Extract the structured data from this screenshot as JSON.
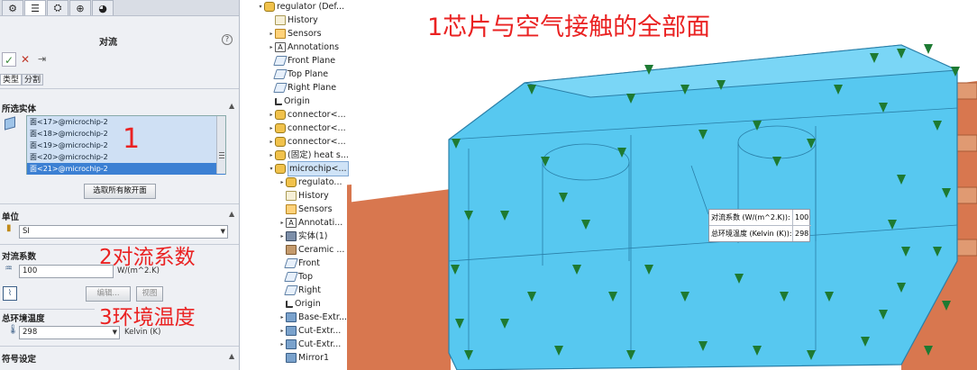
{
  "panel": {
    "tabs": [
      {
        "name": "feature-manager-tab",
        "glyph": "⚙"
      },
      {
        "name": "property-manager-tab",
        "glyph": "☰"
      },
      {
        "name": "configuration-manager-tab",
        "glyph": "⛭"
      },
      {
        "name": "dimxpert-tab",
        "glyph": "⊕"
      },
      {
        "name": "display-manager-tab",
        "glyph": "◕"
      }
    ],
    "title": "对流",
    "help_glyph": "?",
    "ok_glyph": "✓",
    "cancel_glyph": "✕",
    "pin_glyph": "⇥",
    "subtabs": [
      "类型",
      "分割"
    ],
    "selected_entities": {
      "header": "所选实体",
      "items": [
        "面<17>@microchip-2",
        "面<18>@microchip-2",
        "面<19>@microchip-2",
        "面<20>@microchip-2",
        "面<21>@microchip-2"
      ],
      "selected_index": 4
    },
    "select_all_exposed_button": "选取所有敞开面",
    "units": {
      "header": "单位",
      "value": "SI"
    },
    "convection": {
      "header": "对流系数",
      "value": "100",
      "unit": "W/(m^2.K)",
      "edit_button": "编辑...",
      "view_button": "视图"
    },
    "ambient": {
      "header": "总环境温度",
      "value": "298",
      "unit": "Kelvin (K)"
    },
    "sign_settings": {
      "header": "符号设定"
    }
  },
  "annotations": {
    "list_number": "1",
    "convection_note": "2对流系数",
    "temperature_note": "3环境温度",
    "faces_note": "1芯片与空气接触的全部面"
  },
  "tree": {
    "items": [
      {
        "label": "regulator  (Def...",
        "icon": "conn",
        "arrow": "▾"
      },
      {
        "label": "History",
        "icon": "hist",
        "arrow": ""
      },
      {
        "label": "Sensors",
        "icon": "sens",
        "arrow": "▸"
      },
      {
        "label": "Annotations",
        "icon": "anno",
        "arrow": "▸"
      },
      {
        "label": "Front Plane",
        "icon": "plane",
        "arrow": ""
      },
      {
        "label": "Top Plane",
        "icon": "plane",
        "arrow": ""
      },
      {
        "label": "Right Plane",
        "icon": "plane",
        "arrow": ""
      },
      {
        "label": "Origin",
        "icon": "orig",
        "arrow": ""
      },
      {
        "label": "connector<...",
        "icon": "conn",
        "arrow": "▸"
      },
      {
        "label": "connector<...",
        "icon": "conn",
        "arrow": "▸"
      },
      {
        "label": "connector<...",
        "icon": "conn",
        "arrow": "▸"
      },
      {
        "label": "(固定) heat s...",
        "icon": "conn",
        "arrow": "▸"
      },
      {
        "label": "microchip<...",
        "icon": "conn",
        "arrow": "▾"
      },
      {
        "label": "regulato...",
        "icon": "conn",
        "arrow": "▸"
      },
      {
        "label": "History",
        "icon": "hist",
        "arrow": ""
      },
      {
        "label": "Sensors",
        "icon": "sens",
        "arrow": ""
      },
      {
        "label": "Annotati...",
        "icon": "anno",
        "arrow": "▸"
      },
      {
        "label": "实体(1)",
        "icon": "solid",
        "arrow": "▸"
      },
      {
        "label": "Ceramic ...",
        "icon": "ceram",
        "arrow": ""
      },
      {
        "label": "Front",
        "icon": "plane",
        "arrow": ""
      },
      {
        "label": "Top",
        "icon": "plane",
        "arrow": ""
      },
      {
        "label": "Right",
        "icon": "plane",
        "arrow": ""
      },
      {
        "label": "Origin",
        "icon": "orig",
        "arrow": ""
      },
      {
        "label": "Base-Extr...",
        "icon": "feat",
        "arrow": "▸"
      },
      {
        "label": "Cut-Extr...",
        "icon": "feat",
        "arrow": "▸"
      },
      {
        "label": "Cut-Extr...",
        "icon": "feat",
        "arrow": "▸"
      },
      {
        "label": "Mirror1",
        "icon": "feat",
        "arrow": ""
      }
    ]
  },
  "callout": {
    "rows": [
      {
        "label": "对流系数 (W/(m^2.K)):",
        "value": "100"
      },
      {
        "label": "总环境温度 (Kelvin (K)):",
        "value": "298"
      }
    ]
  },
  "colors": {
    "chip": "#57c8f0",
    "board": "#d8774f",
    "marker": "#1e7a32",
    "annotation": "#ea2222"
  }
}
